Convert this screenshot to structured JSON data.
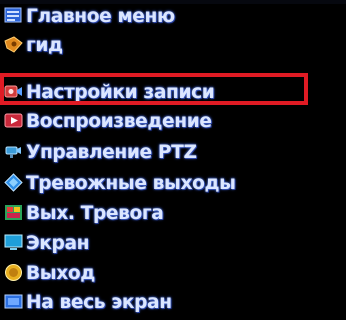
{
  "menu": {
    "items": [
      {
        "label": "Главное меню",
        "icon": "main-menu-icon"
      },
      {
        "label": "гид",
        "icon": "guide-icon"
      },
      {
        "label": "Настройки записи",
        "icon": "record-settings-icon"
      },
      {
        "label": "Воспроизведение",
        "icon": "playback-icon"
      },
      {
        "label": "Управление PTZ",
        "icon": "ptz-icon"
      },
      {
        "label": "Тревожные выходы",
        "icon": "alarm-output-icon"
      },
      {
        "label": "Вых. Тревога",
        "icon": "alarm-exit-icon"
      },
      {
        "label": "Экран",
        "icon": "screen-icon"
      },
      {
        "label": "Выход",
        "icon": "exit-icon"
      },
      {
        "label": "На весь экран",
        "icon": "fullscreen-icon"
      }
    ],
    "highlighted_index": 2
  },
  "colors": {
    "background": "#000000",
    "text": "#dbe6ff",
    "highlight": "#e01b24"
  }
}
